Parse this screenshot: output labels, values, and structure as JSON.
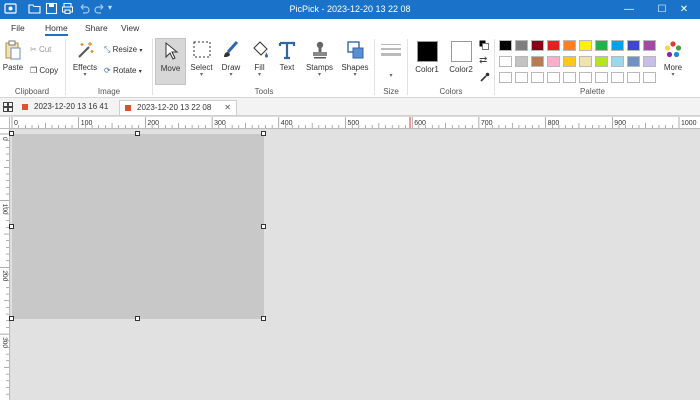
{
  "window": {
    "title": "PicPick - 2023-12-20 13 22 08"
  },
  "ribbon_tabs": [
    "File",
    "Home",
    "Share",
    "View"
  ],
  "groups": {
    "clipboard": "Clipboard",
    "image": "Image",
    "tools": "Tools",
    "size": "Size",
    "colors": "Colors",
    "palette": "Palette"
  },
  "clipboard": {
    "paste": "Paste",
    "cut": "Cut",
    "copy": "Copy"
  },
  "image": {
    "effects": "Effects",
    "resize": "Resize",
    "rotate": "Rotate"
  },
  "tools": {
    "move": "Move",
    "select": "Select",
    "draw": "Draw",
    "fill": "Fill",
    "text": "Text",
    "stamps": "Stamps",
    "shapes": "Shapes"
  },
  "colors": {
    "color1_label": "Color1",
    "color2_label": "Color2",
    "color1": "#000000",
    "color2": "#ffffff"
  },
  "palette": {
    "more": "More",
    "row1": [
      "#000000",
      "#7f7f7f",
      "#880015",
      "#ed1c24",
      "#ff7f27",
      "#fff200",
      "#22b14c",
      "#00a2e8",
      "#3f48cc",
      "#a349a4"
    ],
    "row2": [
      "#ffffff",
      "#c3c3c3",
      "#b97a57",
      "#ffaec9",
      "#ffc90e",
      "#efe4b0",
      "#b5e61d",
      "#99d9ea",
      "#7092be",
      "#c8bfe7"
    ],
    "row3": [
      "#ffffff",
      "#ffffff",
      "#ffffff",
      "#ffffff",
      "#ffffff",
      "#ffffff",
      "#ffffff",
      "#ffffff",
      "#ffffff",
      "#ffffff"
    ]
  },
  "doc_tabs": [
    {
      "title": "2023-12-20 13 16 41",
      "active": false
    },
    {
      "title": "2023-12-20 13 22 08",
      "active": true
    }
  ],
  "rulers": {
    "horizontal": [
      "0",
      "100",
      "200",
      "300",
      "400",
      "500",
      "600",
      "700",
      "800",
      "900",
      "1000"
    ],
    "vertical": [
      "0",
      "100",
      "200",
      "300"
    ]
  },
  "canvas": {
    "background": "#c8c8c8"
  }
}
